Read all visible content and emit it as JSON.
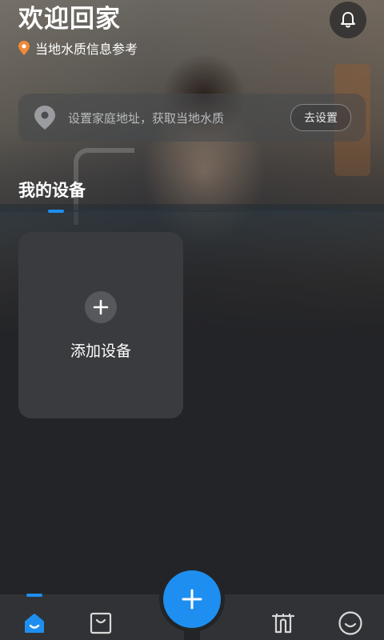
{
  "header": {
    "title": "欢迎回家",
    "subtitle": "当地水质信息参考",
    "bell_icon": "bell-icon",
    "pin_icon": "location-pin-icon"
  },
  "address": {
    "placeholder": "设置家庭地址，获取当地水质",
    "button_label": "去设置",
    "icon": "location-icon"
  },
  "devices": {
    "section_title": "我的设备",
    "add_card": {
      "label": "添加设备",
      "icon": "plus-icon"
    }
  },
  "tabbar": {
    "items": [
      {
        "icon": "home-icon",
        "active": true
      },
      {
        "icon": "shop-bag-icon",
        "active": false
      },
      {
        "icon": "add-fab-icon",
        "active": false
      },
      {
        "icon": "filter-icon",
        "active": false
      },
      {
        "icon": "profile-smile-icon",
        "active": false
      }
    ]
  },
  "colors": {
    "accent": "#1e8ff0",
    "pin_orange": "#ef8a3a",
    "background": "#232427",
    "card": "#3a3b3e"
  }
}
